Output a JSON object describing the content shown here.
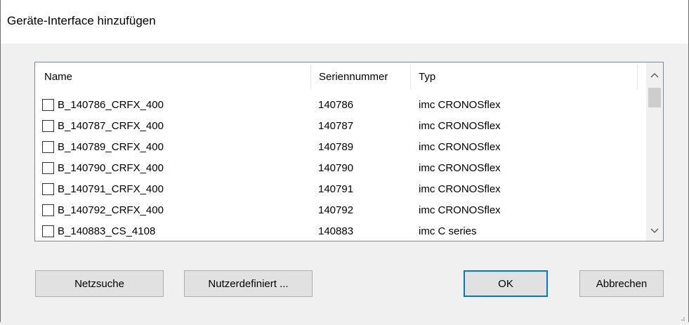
{
  "window": {
    "title": "Geräte-Interface hinzufügen"
  },
  "columns": [
    "Name",
    "Seriennummer",
    "Typ"
  ],
  "rows": [
    {
      "name": "B_140786_CRFX_400",
      "serial": "140786",
      "type": "imc CRONOSflex",
      "checked": false
    },
    {
      "name": "B_140787_CRFX_400",
      "serial": "140787",
      "type": "imc CRONOSflex",
      "checked": false
    },
    {
      "name": "B_140789_CRFX_400",
      "serial": "140789",
      "type": "imc CRONOSflex",
      "checked": false
    },
    {
      "name": "B_140790_CRFX_400",
      "serial": "140790",
      "type": "imc CRONOSflex",
      "checked": false
    },
    {
      "name": "B_140791_CRFX_400",
      "serial": "140791",
      "type": "imc CRONOSflex",
      "checked": false
    },
    {
      "name": "B_140792_CRFX_400",
      "serial": "140792",
      "type": "imc CRONOSflex",
      "checked": false
    },
    {
      "name": "B_140883_CS_4108",
      "serial": "140883",
      "type": "imc C series",
      "checked": false
    }
  ],
  "buttons": {
    "netsearch": "Netzsuche",
    "userdefined": "Nutzerdefiniert ...",
    "ok": "OK",
    "cancel": "Abbrechen"
  },
  "icons": {
    "scroll_up": "chevron-up-icon",
    "scroll_down": "chevron-down-icon",
    "resize": "resize-grip-icon"
  },
  "colors": {
    "accent": "#0078d7",
    "window_bg": "#f0f0f0",
    "list_bg": "#ffffff"
  }
}
